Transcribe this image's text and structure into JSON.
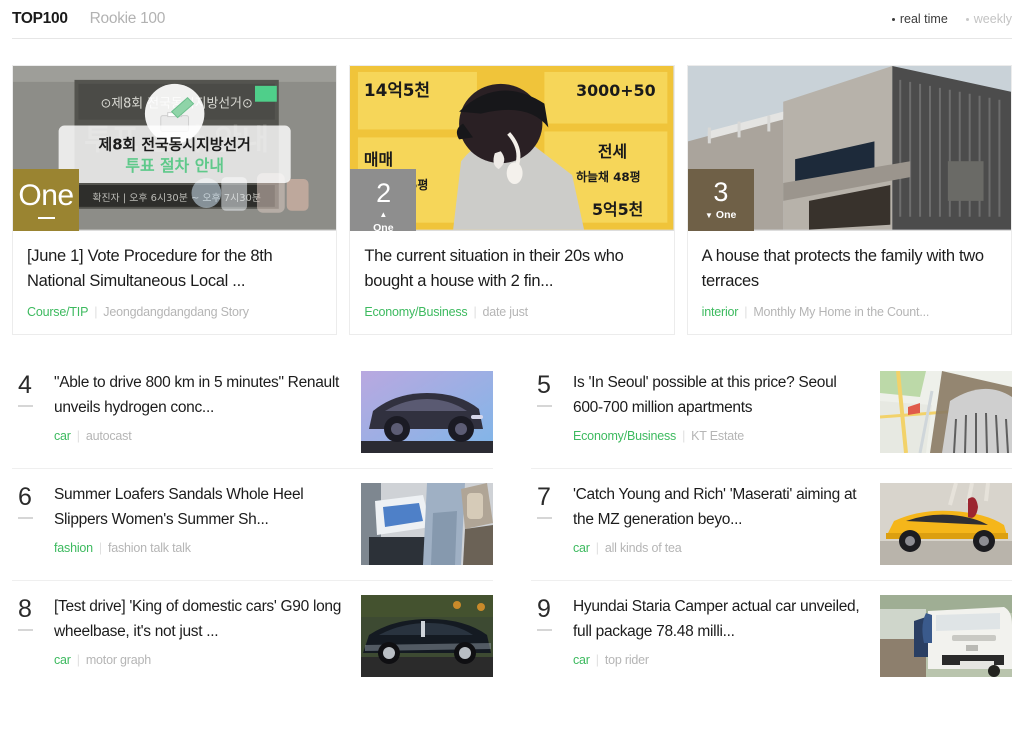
{
  "header": {
    "tabs": [
      {
        "label": "TOP100",
        "active": true
      },
      {
        "label": "Rookie 100",
        "active": false
      }
    ],
    "modes": [
      {
        "label": "real time",
        "active": true
      },
      {
        "label": "weekly",
        "active": false
      }
    ]
  },
  "top_cards": [
    {
      "rank_label": "One",
      "rank_change": "none",
      "rank_change_label": "",
      "badge_color": "#9a8431",
      "title": "[June 1] Vote Procedure for the 8th National Simultaneous Local ...",
      "category": "Course/TIP",
      "source": "Jeongdangdangdang Story",
      "thumb_name": "election-vote-guide-poster"
    },
    {
      "rank_label": "2",
      "rank_change": "up",
      "rank_change_label": "One",
      "badge_color": "#8e8e8e",
      "title": "The current situation in their 20s who bought a house with 2 fin...",
      "category": "Economy/Business",
      "source": "date just",
      "thumb_name": "person-at-real-estate-listings"
    },
    {
      "rank_label": "3",
      "rank_change": "down",
      "rank_change_label": "One",
      "badge_color": "#6f6047",
      "title": "A house that protects the family with two terraces",
      "category": "interior",
      "source": "Monthly My Home in the Count...",
      "thumb_name": "modern-brick-house"
    }
  ],
  "list_rows": [
    {
      "rank": "4",
      "rank_change": "none",
      "title": "\"Able to drive 800 km in 5 minutes\" Renault unveils hydrogen conc...",
      "category": "car",
      "source": "autocast",
      "thumb_name": "renault-hydrogen-concept-car"
    },
    {
      "rank": "5",
      "rank_change": "none",
      "title": "Is 'In Seoul' possible at this price? Seoul 600-700 million apartments",
      "category": "Economy/Business",
      "source": "KT Estate",
      "thumb_name": "seoul-map-apartments"
    },
    {
      "rank": "6",
      "rank_change": "none",
      "title": "Summer Loafers Sandals Whole Heel Slippers Women's Summer Sh...",
      "category": "fashion",
      "source": "fashion talk talk",
      "thumb_name": "summer-sandals-street-photo"
    },
    {
      "rank": "7",
      "rank_change": "none",
      "title": "'Catch Young and Rich' 'Maserati' aiming at the MZ generation beyo...",
      "category": "car",
      "source": "all kinds of tea",
      "thumb_name": "yellow-maserati-suv"
    },
    {
      "rank": "8",
      "rank_change": "none",
      "title": "[Test drive] 'King of domestic cars' G90 long wheelbase, it's not just ...",
      "category": "car",
      "source": "motor graph",
      "thumb_name": "black-genesis-g90-sedan"
    },
    {
      "rank": "9",
      "rank_change": "none",
      "title": "Hyundai Staria Camper actual car unveiled, full package 78.48 milli...",
      "category": "car",
      "source": "top rider",
      "thumb_name": "white-hyundai-staria-camper"
    }
  ],
  "colors": {
    "accent_category": "#3dba5f",
    "text_primary": "#1c1c1c",
    "text_muted": "#b5b5b5",
    "divider": "#efefef"
  },
  "icons": {
    "bullet": "•",
    "triangle_up": "▲",
    "triangle_down": "▼"
  }
}
